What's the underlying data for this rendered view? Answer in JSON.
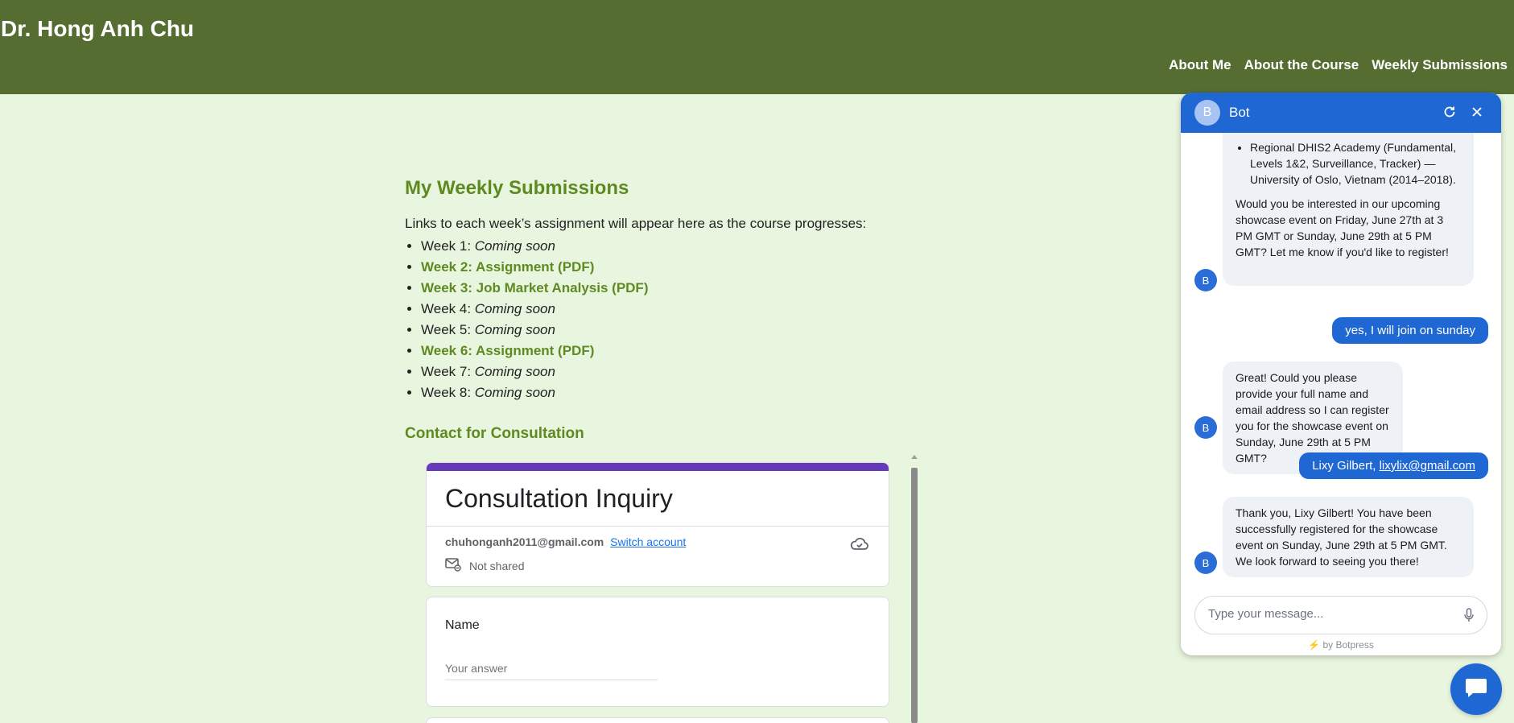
{
  "site": {
    "title": "Dr. Hong Anh Chu",
    "nav": [
      "About Me",
      "About the Course",
      "Weekly Submissions"
    ]
  },
  "submissions": {
    "heading": "My Weekly Submissions",
    "intro": "Links to each week’s assignment will appear here as the course progresses:",
    "weeks": [
      {
        "prefix": "Week 1: ",
        "status": "Coming soon"
      },
      {
        "link": "Week 2: Assignment (PDF)"
      },
      {
        "link": "Week 3: Job Market Analysis (PDF)"
      },
      {
        "prefix": "Week 4: ",
        "status": "Coming soon"
      },
      {
        "prefix": "Week 5: ",
        "status": "Coming soon"
      },
      {
        "link": "Week 6: Assignment (PDF)"
      },
      {
        "prefix": "Week 7: ",
        "status": "Coming soon"
      },
      {
        "prefix": "Week 8: ",
        "status": "Coming soon"
      }
    ]
  },
  "contact": {
    "heading": "Contact for Consultation",
    "form": {
      "title": "Consultation Inquiry",
      "email": "chuhonganh2011@gmail.com",
      "switch_account": "Switch account",
      "not_shared": "Not shared",
      "name_label": "Name",
      "name_placeholder": "Your answer"
    }
  },
  "chat": {
    "bot_initial": "B",
    "bot_name": "Bot",
    "academy_item": "Regional DHIS2 Academy (Fundamental, Levels 1&2, Surveillance, Tracker) — University of Oslo, Vietnam (2014–2018).",
    "msg_showcase": "Would you be interested in our upcoming showcase event on Friday, June 27th at 3 PM GMT or Sunday, June 29th at 5 PM GMT? Let me know if you'd like to register!",
    "user_msg_1": "yes, I will join on sunday",
    "msg_request_details": "Great! Could you please provide your full name and email address so I can register you for the showcase event on Sunday, June 29th at 5 PM GMT?",
    "user_msg_2_name": "Lixy Gilbert, ",
    "user_msg_2_email": "lixylix@gmail.com",
    "msg_confirm": "Thank you, Lixy Gilbert! You have been successfully registered for the showcase event on Sunday, June 29th at 5 PM GMT. We look forward to seeing you there!",
    "input_placeholder": "Type your message...",
    "powered_by": "by Botpress"
  },
  "colors": {
    "header_bg": "#566d32",
    "page_bg": "#e9f6df",
    "accent_green": "#5f8a22",
    "form_purple": "#673ab7",
    "chat_blue": "#1f68d4"
  },
  "icons": [
    "refresh-icon",
    "close-icon",
    "cloud-check-icon",
    "mail-icon",
    "mic-icon",
    "bolt-icon",
    "chat-bubble-icon"
  ]
}
